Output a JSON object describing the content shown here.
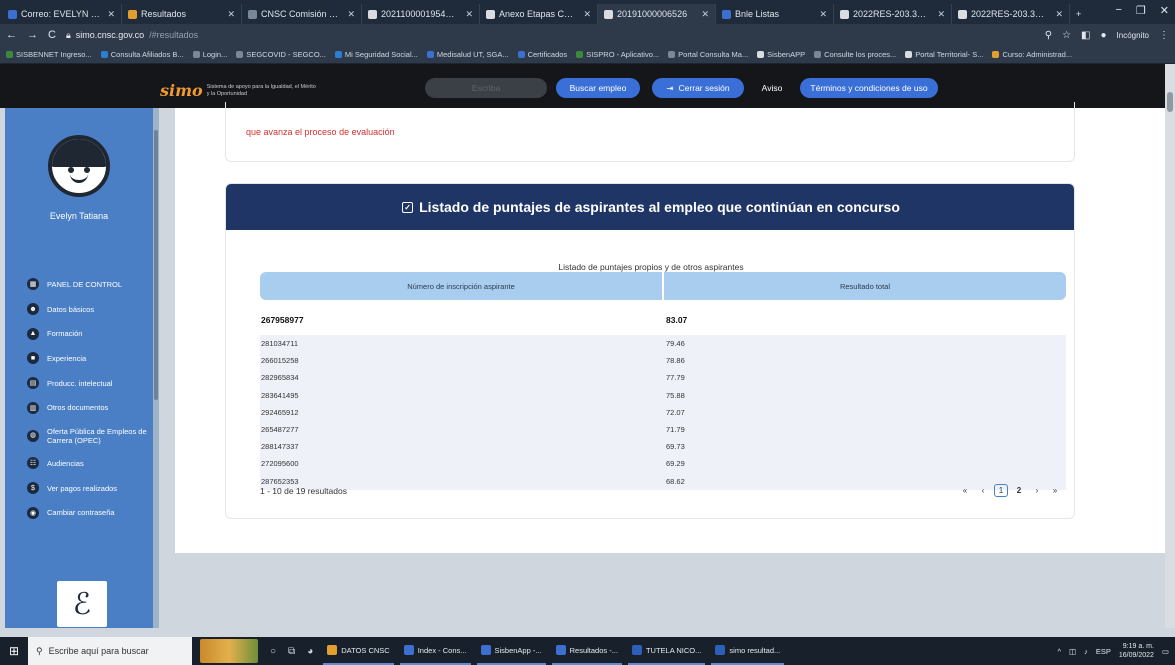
{
  "browser": {
    "tabs": [
      {
        "title": "Correo: EVELYN TATIA",
        "color": "#3b6fd0",
        "active": false
      },
      {
        "title": "Resultados",
        "color": "#e0a030",
        "active": false
      },
      {
        "title": "CNSC Comisión Nacio",
        "color": "#7a8796",
        "active": false
      },
      {
        "title": "20211000019546.pdf",
        "color": "#d9dde1",
        "active": false
      },
      {
        "title": "Anexo Etapas Concur",
        "color": "#d9dde1",
        "active": false
      },
      {
        "title": "20191000006526",
        "color": "#d9dde1",
        "active": true
      },
      {
        "title": "Bnle Listas",
        "color": "#3b6fd0",
        "active": false
      },
      {
        "title": "2022RES-203.300.24-",
        "color": "#d9dde1",
        "active": false
      },
      {
        "title": "2022RES-203.300.24-",
        "color": "#d9dde1",
        "active": false
      }
    ],
    "new_tab_label": "+",
    "url_domain": "simo.cnsc.gov.co",
    "url_path": "/#resultados",
    "incognito_label": "Incógnito",
    "bookmarks": [
      "SISBENNET Ingreso...",
      "Consulta Afiliados B...",
      "Login...",
      "SEGCOVID - SEGCO...",
      "Mi Seguridad Social...",
      "Medisalud UT, SGA...",
      "Certificados",
      "SISPRO - Aplicativo...",
      "Portal Consulta Ma...",
      "SisbenAPP",
      "Consulte los proces...",
      "Portal Territorial- S...",
      "Curso: Administrad..."
    ]
  },
  "header": {
    "logo_mark": "simo",
    "logo_subtitle": "Sistema de apoyo para la Igualdad, el Mérito y la Oportunidad",
    "search_placeholder": "Escriba",
    "buscar_label": "Buscar empleo",
    "cerrar_label": "Cerrar sesión",
    "aviso_label": "Aviso",
    "terminos_label": "Términos y condiciones de uso"
  },
  "sidebar": {
    "username": "Evelyn Tatiana",
    "items": [
      {
        "label": "PANEL DE CONTROL",
        "icon": "dashboard-icon",
        "glyph": "▦"
      },
      {
        "label": "Datos básicos",
        "icon": "people-icon",
        "glyph": "☻"
      },
      {
        "label": "Formación",
        "icon": "graduation-icon",
        "glyph": "▲"
      },
      {
        "label": "Experiencia",
        "icon": "briefcase-icon",
        "glyph": "■"
      },
      {
        "label": "Producc. intelectual",
        "icon": "book-icon",
        "glyph": "▤"
      },
      {
        "label": "Otros documentos",
        "icon": "document-icon",
        "glyph": "▥"
      },
      {
        "label": "Oferta Pública de Empleos de Carrera (OPEC)",
        "icon": "globe-icon",
        "glyph": "◍",
        "tall": true
      },
      {
        "label": "Audiencias",
        "icon": "audience-icon",
        "glyph": "☷"
      },
      {
        "label": "Ver pagos realizados",
        "icon": "dollar-icon",
        "glyph": "$"
      },
      {
        "label": "Cambiar contraseña",
        "icon": "lock-icon",
        "glyph": "◉"
      }
    ]
  },
  "main": {
    "previous_card_text": "que avanza el proceso de evaluación",
    "card_title": "Listado de puntajes de aspirantes al empleo que continúan en concurso",
    "table_caption": "Listado de puntajes propios y de otros aspirantes",
    "columns": [
      "Número de inscripción aspirante",
      "Resultado total"
    ],
    "own_row": {
      "id": "267958977",
      "score": "83.07"
    },
    "rows": [
      {
        "id": "281034711",
        "score": "79.46"
      },
      {
        "id": "266015258",
        "score": "78.86"
      },
      {
        "id": "282965834",
        "score": "77.79"
      },
      {
        "id": "283641495",
        "score": "75.88"
      },
      {
        "id": "292465912",
        "score": "72.07"
      },
      {
        "id": "265487277",
        "score": "71.79"
      },
      {
        "id": "288147337",
        "score": "69.73"
      },
      {
        "id": "272095600",
        "score": "69.29"
      },
      {
        "id": "287652353",
        "score": "68.62"
      }
    ],
    "results_summary": "1 - 10 de 19 resultados",
    "pagination": {
      "first": "«",
      "prev": "‹",
      "pages": [
        "1",
        "2"
      ],
      "current": "1",
      "next": "›",
      "last": "»"
    }
  },
  "taskbar": {
    "search_placeholder": "Escribe aquí para buscar",
    "apps": [
      {
        "label": "DATOS CNSC",
        "color": "#e0a030"
      },
      {
        "label": "Index - Cons...",
        "color": "#3b6fd0"
      },
      {
        "label": "SisbenApp -...",
        "color": "#3b6fd0"
      },
      {
        "label": "Resultados -...",
        "color": "#3b6fd0"
      },
      {
        "label": "TUTELA NICO...",
        "color": "#2b5fb8"
      },
      {
        "label": "simo resultad...",
        "color": "#2b5fb8"
      }
    ],
    "language": "ESP",
    "time": "9:19 a. m.",
    "date": "16/09/2022"
  }
}
